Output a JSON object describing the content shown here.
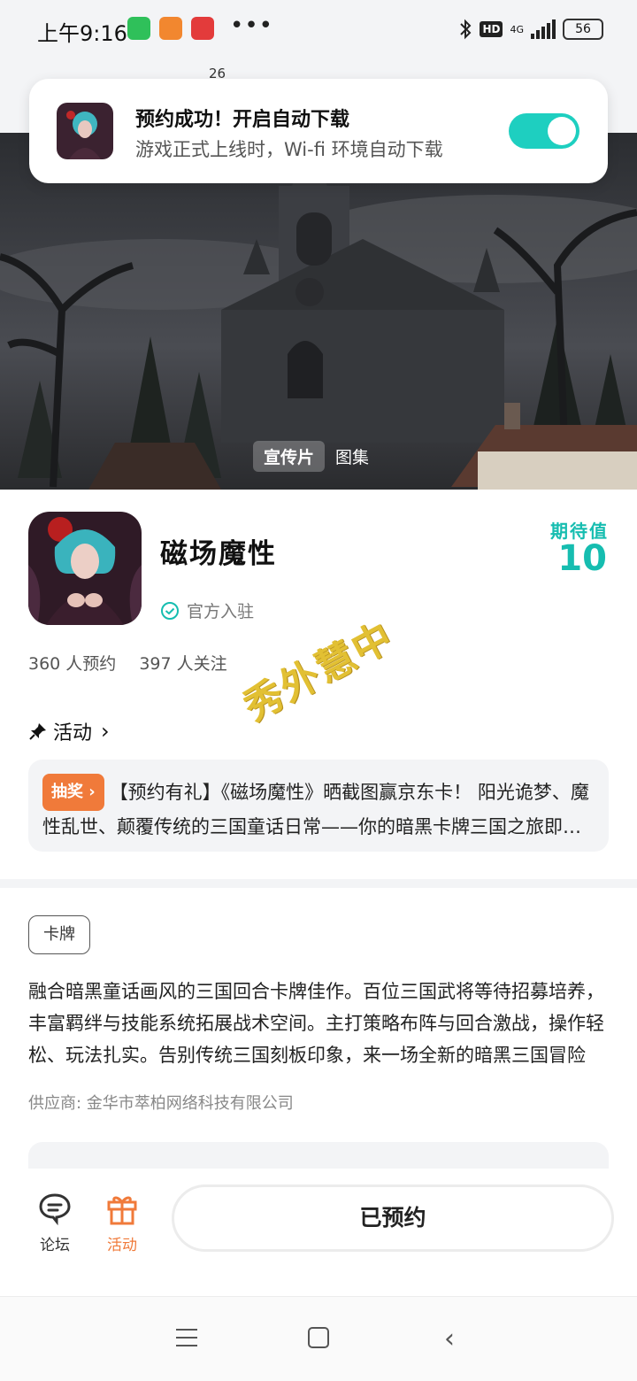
{
  "status_bar": {
    "time": "上午9:16",
    "hd_label": "HD",
    "network": "4G",
    "battery": "56",
    "more_dots": "•••"
  },
  "header": {
    "count": "26"
  },
  "toast": {
    "title": "预约成功！开启自动下载",
    "subtitle": "游戏正式上线时，Wi-fi 环境自动下载",
    "toggle_on": true
  },
  "media_tabs": [
    {
      "label": "宣传片",
      "active": true
    },
    {
      "label": "图集",
      "active": false
    }
  ],
  "game": {
    "name": "磁场魔性",
    "official_label": "官方入驻",
    "expect_label": "期待值",
    "expect_value": "10",
    "reservations": "360 人预约",
    "followers": "397 人关注"
  },
  "watermark": "秀外慧中",
  "activity": {
    "heading": "活动",
    "badge": "抽奖",
    "text": "【预约有礼】《磁场魔性》晒截图赢京东卡！ 阳光诡梦、魔性乱世、颠覆传统的三国童话日常——你的暗黑卡牌三国之旅即将开启"
  },
  "details": {
    "tag": "卡牌",
    "description": "融合暗黑童话画风的三国回合卡牌佳作。百位三国武将等待招募培养，丰富羁绊与技能系统拓展战术空间。主打策略布阵与回合激战，操作轻松、玩法扎实。告别传统三国刻板印象，来一场全新的暗黑三国冒险",
    "supplier": "供应商: 金华市萃柏网络科技有限公司"
  },
  "bottom_bar": {
    "forum_label": "论坛",
    "activity_label": "活动",
    "reserved_label": "已预约"
  },
  "colors": {
    "accent_teal": "#16bdb0",
    "toggle": "#1ecfc0",
    "accent_orange": "#f07a3a",
    "watermark": "#e2c033"
  }
}
